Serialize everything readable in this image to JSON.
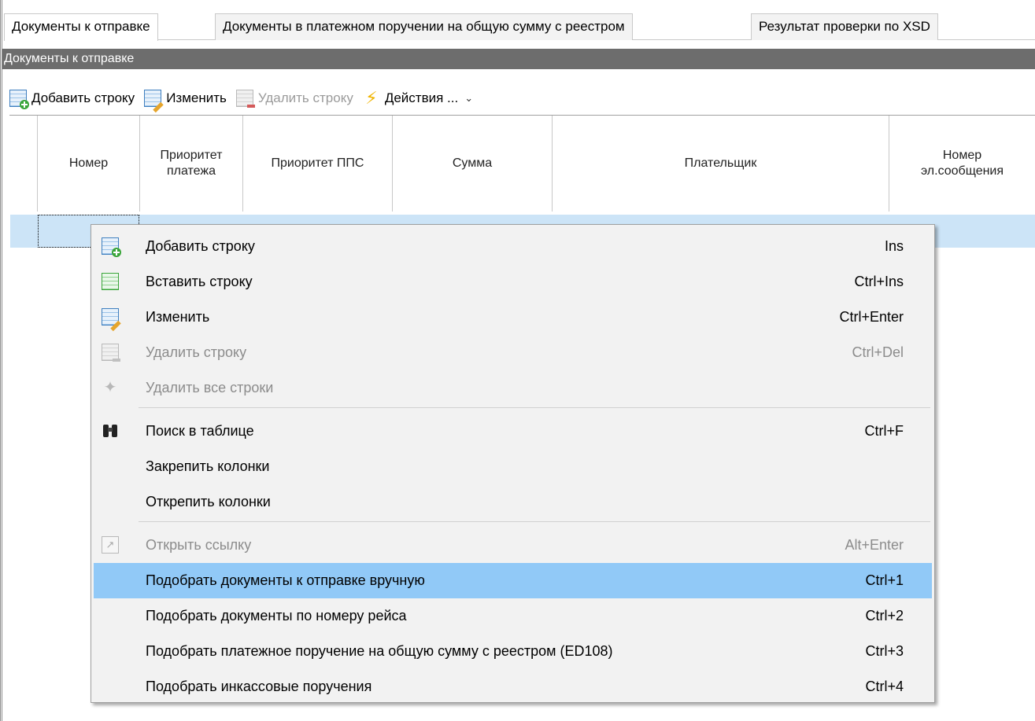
{
  "tabs": [
    {
      "label": "Документы к отправке",
      "active": true
    },
    {
      "label": "Документы в платежном поручении на общую сумму с реестром",
      "active": false
    },
    {
      "label": "Результат проверки по XSD",
      "active": false
    }
  ],
  "band": {
    "title": "Документы к отправке"
  },
  "toolbar": {
    "add_label": "Добавить строку",
    "edit_label": "Изменить",
    "delete_label": "Удалить строку",
    "actions_label": "Действия ...",
    "add_icon": "grid-add-icon",
    "edit_icon": "grid-edit-icon",
    "delete_icon": "grid-delete-icon",
    "actions_icon": "lightning-icon"
  },
  "grid": {
    "columns": [
      {
        "label": "Номер"
      },
      {
        "label": "Приоритет\nплатежа"
      },
      {
        "label": "Приоритет ППС"
      },
      {
        "label": "Сумма"
      },
      {
        "label": "Плательщик"
      },
      {
        "label": "Номер\nэл.сообщения"
      }
    ],
    "selection_color": "#cce4f7"
  },
  "context_menu": {
    "highlight_color": "#91c9f7",
    "items": [
      {
        "label": "Добавить строку",
        "shortcut": "Ins",
        "icon": "grid-add-icon",
        "enabled": true
      },
      {
        "label": "Вставить строку",
        "shortcut": "Ctrl+Ins",
        "icon": "grid-insert-icon",
        "enabled": true
      },
      {
        "label": "Изменить",
        "shortcut": "Ctrl+Enter",
        "icon": "grid-edit-icon",
        "enabled": true
      },
      {
        "label": "Удалить строку",
        "shortcut": "Ctrl+Del",
        "icon": "grid-delete-icon",
        "enabled": false
      },
      {
        "label": "Удалить все строки",
        "shortcut": "",
        "icon": "broom-icon",
        "enabled": false
      },
      {
        "label": "Поиск в таблице",
        "shortcut": "Ctrl+F",
        "icon": "binoculars-icon",
        "enabled": true
      },
      {
        "label": "Закрепить колонки",
        "shortcut": "",
        "icon": "",
        "enabled": true
      },
      {
        "label": "Открепить колонки",
        "shortcut": "",
        "icon": "",
        "enabled": true
      },
      {
        "label": "Открыть ссылку",
        "shortcut": "Alt+Enter",
        "icon": "open-link-icon",
        "enabled": false
      },
      {
        "label": "Подобрать документы к отправке вручную",
        "shortcut": "Ctrl+1",
        "icon": "",
        "enabled": true,
        "highlighted": true
      },
      {
        "label": "Подобрать документы по номеру рейса",
        "shortcut": "Ctrl+2",
        "icon": "",
        "enabled": true
      },
      {
        "label": "Подобрать платежное поручение на общую сумму с реестром (ED108)",
        "shortcut": "Ctrl+3",
        "icon": "",
        "enabled": true
      },
      {
        "label": "Подобрать инкассовые поручения",
        "shortcut": "Ctrl+4",
        "icon": "",
        "enabled": true
      }
    ]
  }
}
